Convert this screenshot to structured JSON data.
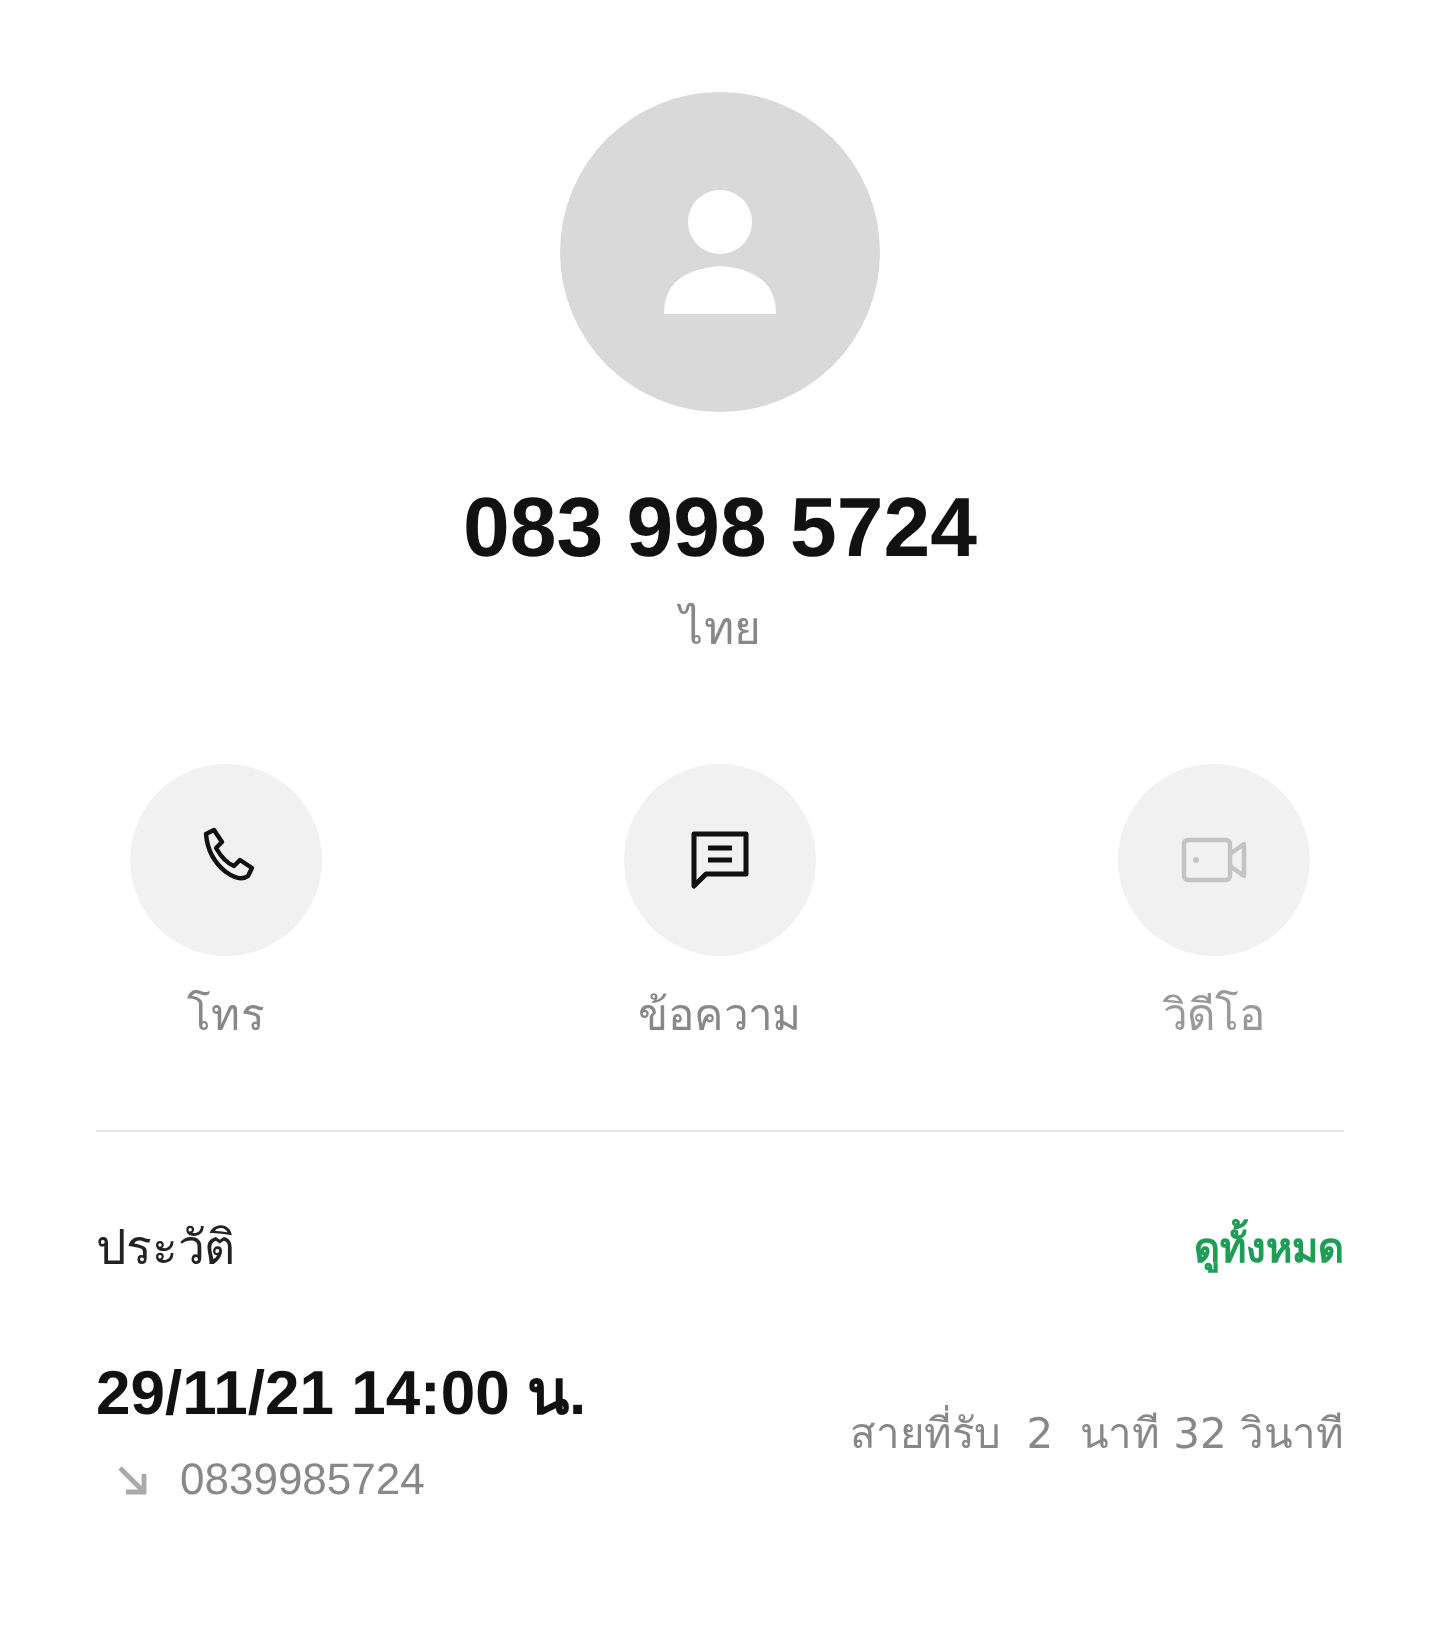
{
  "contact": {
    "number": "083 998 5724",
    "location": "ไทย"
  },
  "actions": [
    {
      "kind": "call",
      "label": "โทร",
      "disabled": false
    },
    {
      "kind": "message",
      "label": "ข้อความ",
      "disabled": false
    },
    {
      "kind": "video",
      "label": "วิดีโอ",
      "disabled": true
    }
  ],
  "history": {
    "title": "ประวัติ",
    "link": "ดูทั้งหมด",
    "entries": [
      {
        "time": "29/11/21 14:00 น.",
        "incoming": true,
        "number": "0839985724",
        "detail": "สายที่รับ  2  นาที 32 วินาที"
      }
    ]
  }
}
